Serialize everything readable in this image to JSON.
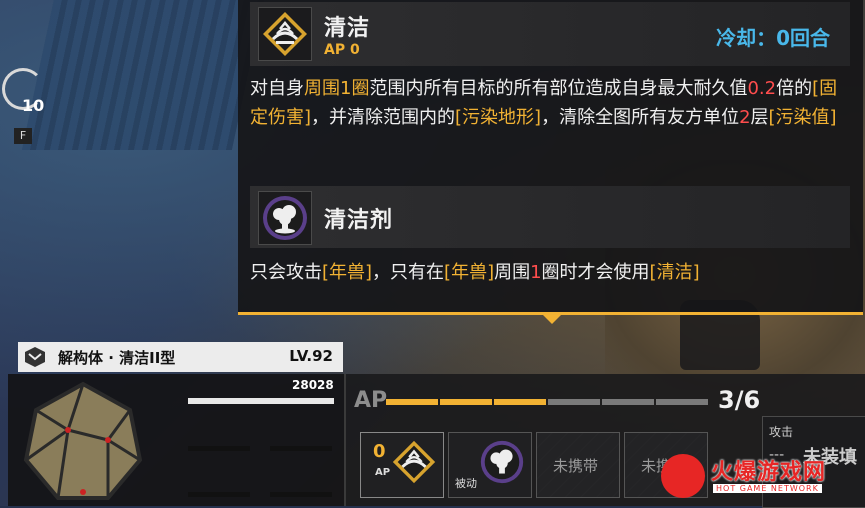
{
  "timer": {
    "value": "10",
    "key": "F"
  },
  "skill1": {
    "name": "清洁",
    "ap_text": "AP 0",
    "cooldown": "冷却：0回合",
    "desc_parts": [
      {
        "t": "对自身",
        "c": "n"
      },
      {
        "t": "周围1圈",
        "c": "hl"
      },
      {
        "t": "范围内所有目标的所有部位造成自身最大耐久值",
        "c": "n"
      },
      {
        "t": "0.2",
        "c": "red"
      },
      {
        "t": "倍的",
        "c": "n"
      },
      {
        "t": "[固定伤害]",
        "c": "hl"
      },
      {
        "t": "，并清除范围内的",
        "c": "n"
      },
      {
        "t": "[污染地形]",
        "c": "hl"
      },
      {
        "t": "，清除全图所有友方单位",
        "c": "n"
      },
      {
        "t": "2",
        "c": "red"
      },
      {
        "t": "层",
        "c": "n"
      },
      {
        "t": "[污染值]",
        "c": "hl"
      }
    ]
  },
  "skill2": {
    "name": "清洁剂",
    "desc_parts": [
      {
        "t": "只会攻击",
        "c": "n"
      },
      {
        "t": "[年兽]",
        "c": "hl"
      },
      {
        "t": "，只有在",
        "c": "n"
      },
      {
        "t": "[年兽]",
        "c": "hl"
      },
      {
        "t": "周围",
        "c": "n"
      },
      {
        "t": "1",
        "c": "red"
      },
      {
        "t": "圈时才会使用",
        "c": "n"
      },
      {
        "t": "[清洁]",
        "c": "hl"
      }
    ]
  },
  "unit": {
    "name": "解构体 · 清洁II型",
    "level": "LV.92",
    "hp": "28028",
    "hp_fraction": 1.0
  },
  "ap": {
    "label": "AP",
    "count": "3/6",
    "current": 3,
    "max": 6
  },
  "slots": [
    {
      "ap": "0",
      "ap_tag": "AP",
      "kind": "active"
    },
    {
      "passive": "被动",
      "kind": "passive"
    },
    {
      "empty": "未携带",
      "kind": "empty"
    },
    {
      "empty": "未携带",
      "kind": "empty"
    }
  ],
  "attack": {
    "label": "攻击",
    "dash": "---",
    "value": "未装填"
  },
  "watermark": {
    "title": "火爆游戏网",
    "subtitle": "HOT GAME NETWORK"
  },
  "colors": {
    "accent": "#f2b233",
    "cooldown": "#49b8ea",
    "highlight_red": "#ff4d4d",
    "ap_empty": "#7a7a7a"
  }
}
